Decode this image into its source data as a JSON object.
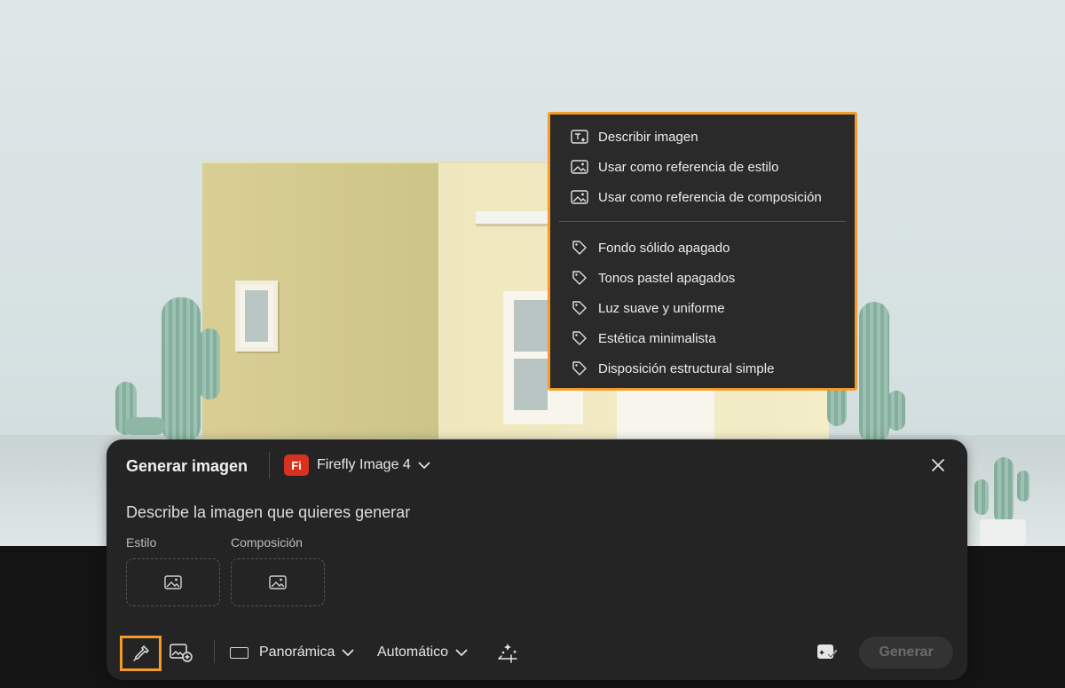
{
  "context_menu": {
    "actions": [
      {
        "label": "Describir imagen",
        "icon": "text-image-icon"
      },
      {
        "label": "Usar como referencia de estilo",
        "icon": "image-icon"
      },
      {
        "label": "Usar como referencia de composición",
        "icon": "image-icon"
      }
    ],
    "tags": [
      {
        "label": "Fondo sólido apagado",
        "icon": "tag-icon"
      },
      {
        "label": "Tonos pastel apagados",
        "icon": "tag-icon"
      },
      {
        "label": "Luz suave y uniforme",
        "icon": "tag-icon"
      },
      {
        "label": "Estética minimalista",
        "icon": "tag-icon"
      },
      {
        "label": "Disposición estructural simple",
        "icon": "tag-icon"
      }
    ]
  },
  "panel": {
    "title": "Generar imagen",
    "model": {
      "badge": "Fi",
      "name": "Firefly Image 4"
    },
    "prompt_placeholder": "Describe la imagen que quieres generar",
    "style_label": "Estilo",
    "composition_label": "Composición",
    "aspect_ratio": "Panorámica",
    "content_type": "Automático",
    "generate_label": "Generar"
  },
  "colors": {
    "highlight": "#f39a2b",
    "badge": "#d9311f",
    "panel": "#242424",
    "menu": "#2a2a2a"
  }
}
